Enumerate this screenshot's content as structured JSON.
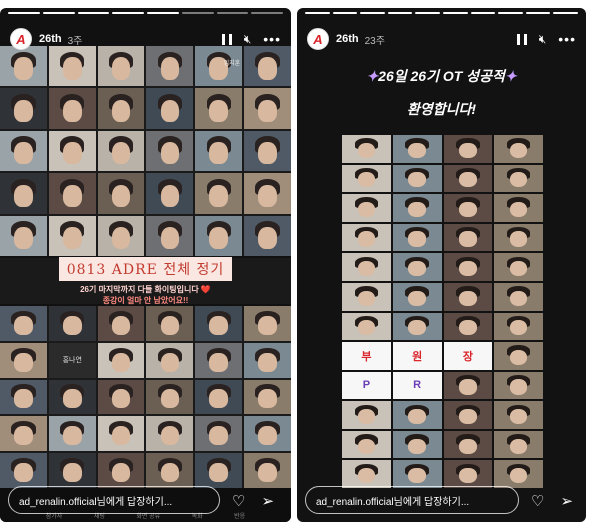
{
  "colors": {
    "accent": "#d9252b",
    "story_bg": "#111111",
    "title_red": "#c23b2f"
  },
  "left_story": {
    "username": "26th",
    "time": "3주",
    "avatar_letter": "A",
    "progress_segments": 8,
    "progress_done": 5,
    "top_names": [
      "임지훈",
      "",
      "",
      "",
      "",
      ""
    ],
    "center_name_top": "",
    "title": "0813 ADRE 전체 정기",
    "subtitle1": "26기 마지막까지 다들 화이팅입니다 ❤️",
    "subtitle2": "종강이 얼마 안 남았어요!!",
    "dark_tile_name": "홍나연",
    "dock_labels": [
      "참가자",
      "채팅",
      "화면 공유",
      "녹화",
      "반응"
    ],
    "reply_placeholder": "ad_renalin.official님에게 답장하기...",
    "icons": [
      "pause-icon",
      "mute-icon",
      "more-icon",
      "heart-icon",
      "send-icon"
    ]
  },
  "right_story": {
    "username": "26th",
    "time": "23주",
    "avatar_letter": "A",
    "progress_segments": 10,
    "progress_done": 10,
    "headline_line1": "26일 26기 OT 성공적",
    "headline_line2": "환영합니다!",
    "sign_words": [
      "부",
      "원",
      "장",
      "P",
      "R"
    ],
    "reply_placeholder": "ad_renalin.official님에게 답장하기...",
    "icons": [
      "pause-icon",
      "mute-icon",
      "more-icon",
      "heart-icon",
      "send-icon"
    ]
  }
}
